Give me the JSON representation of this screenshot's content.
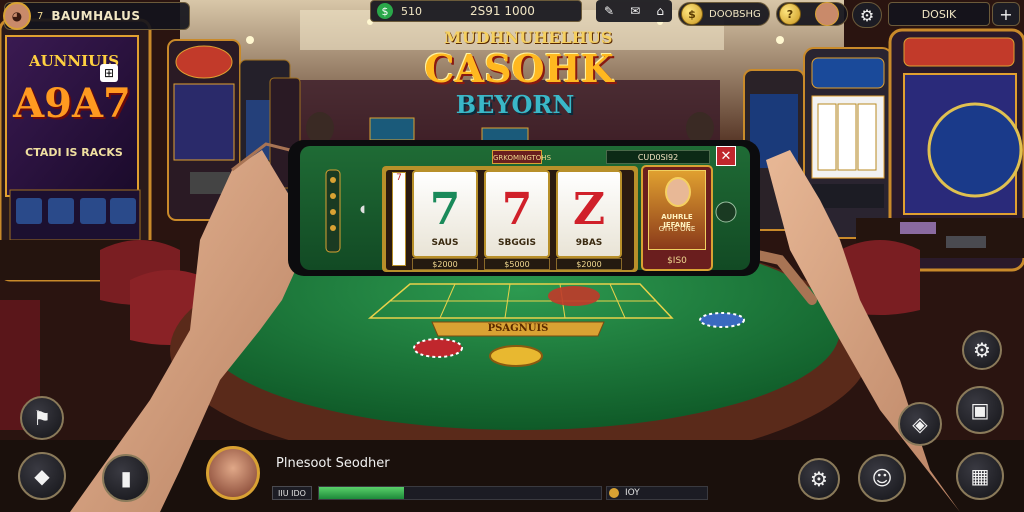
{
  "player": {
    "name": "BAUMHALUS",
    "level": "7"
  },
  "top_center": {
    "stat_left": "510",
    "stat_main": "2S91 1000"
  },
  "top_right": {
    "gold_balance": "DOOBSHG",
    "panel_label": "DOSIK"
  },
  "logo": {
    "top_line": "MUDHNUHELHUS",
    "main": "CASOHK",
    "sub": "BEYORN"
  },
  "left_machine": {
    "title": "AUNNIUIS",
    "big": "A9A7",
    "sub": "CTADI IS RACKS"
  },
  "game": {
    "header_label": "GRKOMINGTOHS",
    "counter": "CUD0SI92",
    "reels": [
      {
        "symbol": "7",
        "label": "SAUS",
        "bet": "$2000"
      },
      {
        "symbol": "7",
        "label": "SBGGIS",
        "bet": "$5000"
      },
      {
        "symbol": "Z",
        "label": "9BAS",
        "bet": "$2000"
      }
    ],
    "character": {
      "caption": "AUHRLE JEFANE",
      "sub": "GTHS ONE",
      "value": "$IS0"
    }
  },
  "table": {
    "banner": "PSAGNUIS"
  },
  "bottom": {
    "player_name": "Plnesoot Seodher",
    "left_value": "IIU IDO",
    "right_value": "IOY",
    "progress": 0.3
  },
  "colors": {
    "felt": "#1e7a3c",
    "gold": "#d9a233",
    "accent_red": "#c0272d"
  }
}
